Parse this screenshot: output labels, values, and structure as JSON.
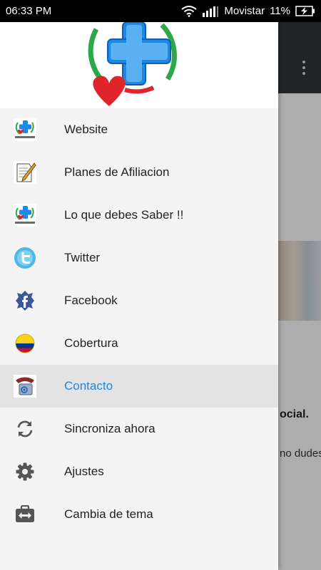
{
  "status_bar": {
    "time": "06:33 PM",
    "carrier": "Movistar",
    "battery": "11%"
  },
  "background": {
    "text1": "ocial.",
    "text2": "no dudes"
  },
  "drawer": {
    "items": [
      {
        "label": "Website",
        "icon": "servisalud-logo-icon",
        "active": false
      },
      {
        "label": "Planes de Afiliacion",
        "icon": "document-pen-icon",
        "active": false
      },
      {
        "label": "Lo que debes Saber !!",
        "icon": "servisalud-logo-icon",
        "active": false
      },
      {
        "label": "Twitter",
        "icon": "twitter-icon",
        "active": false
      },
      {
        "label": "Facebook",
        "icon": "facebook-icon",
        "active": false
      },
      {
        "label": "Cobertura",
        "icon": "colombia-flag-icon",
        "active": false
      },
      {
        "label": "Contacto",
        "icon": "phone-mail-icon",
        "active": true
      },
      {
        "label": "Sincroniza ahora",
        "icon": "sync-icon",
        "active": false
      },
      {
        "label": "Ajustes",
        "icon": "gear-icon",
        "active": false
      },
      {
        "label": "Cambia de tema",
        "icon": "theme-switch-icon",
        "active": false
      }
    ]
  },
  "colors": {
    "active_text": "#1e88e5",
    "toolbar": "#2d3336",
    "logo_red": "#e0252a",
    "logo_green": "#2aa84a",
    "logo_blue": "#1e88e5"
  }
}
